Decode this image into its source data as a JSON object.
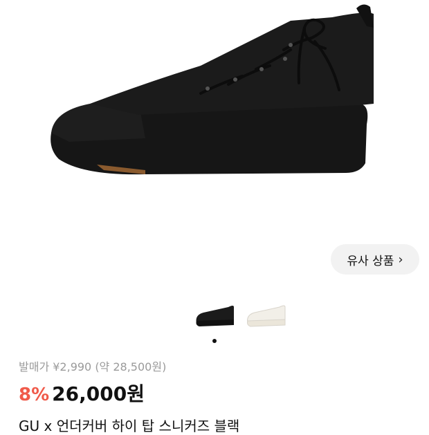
{
  "product": {
    "image_alt": "black high-top sneaker",
    "similar_button_label": "유사 상품",
    "similar_button_icon": "chevron-right-icon",
    "thumbnails": [
      {
        "label": "black",
        "color": "#1b1b1b"
      },
      {
        "label": "white",
        "color": "#f2efe8"
      }
    ],
    "original_price": "발매가 ¥2,990 (약 28,500원)",
    "discount": "8%",
    "price": "26,000원",
    "title": "GU x 언더커버 하이 탑 스니커즈 블랙"
  },
  "colors": {
    "discount": "#f05a4a",
    "muted": "#9a9a9a"
  }
}
